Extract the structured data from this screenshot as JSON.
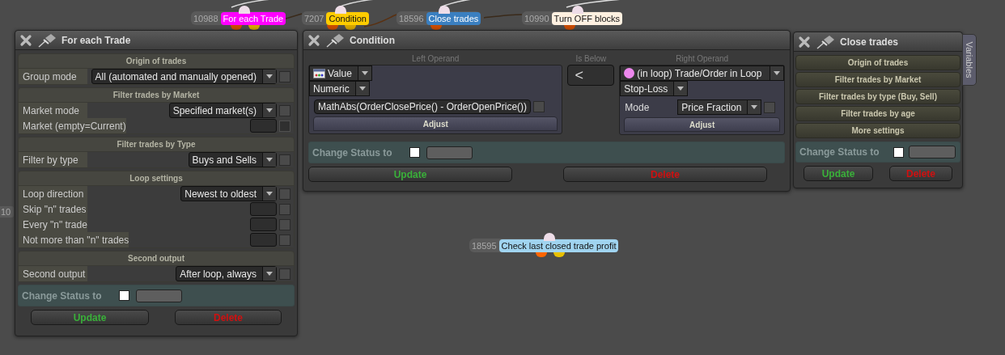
{
  "nodes": [
    {
      "number": "10988",
      "label": "For each Trade",
      "color": "#ff00ff",
      "outputs": [
        {
          "color": "#c84a00"
        },
        {
          "color": "#d4a400"
        }
      ]
    },
    {
      "number": "7207",
      "label": "Condition",
      "color": "#ffcc00",
      "outputs": [
        {
          "color": "#c84a00"
        },
        {
          "color": "#d4a400"
        }
      ]
    },
    {
      "number": "18596",
      "label": "Close trades",
      "color": "#3a7fc0",
      "outputs": [
        {
          "color": "#c84a00"
        }
      ]
    },
    {
      "number": "10990",
      "label": "Turn OFF blocks",
      "color": "#fff0e0",
      "outputs": [
        {
          "color": "#c84a00"
        }
      ]
    },
    {
      "number": "18595",
      "label": "Check last closed trade profit",
      "color": "#a0d4f0",
      "outputs": [
        {
          "color": "#ff6600"
        },
        {
          "color": "#e8c000"
        }
      ]
    }
  ],
  "cut_node": {
    "number": "10"
  },
  "for_each_panel": {
    "title": "For each Trade",
    "sections": [
      {
        "heading": "Origin of trades",
        "rows": [
          {
            "kind": "select",
            "label": "Group mode",
            "value": "All (automated and manually opened)",
            "checked": false,
            "disabled": false
          }
        ]
      },
      {
        "heading": "Filter trades by Market",
        "rows": [
          {
            "kind": "select",
            "label": "Market mode",
            "value": "Specified market(s)",
            "checked": false,
            "disabled": false
          },
          {
            "kind": "input",
            "label": "Market (empty=Current)",
            "checked": false,
            "disabled": true
          }
        ]
      },
      {
        "heading": "Filter trades by Type",
        "rows": [
          {
            "kind": "select",
            "label": "Filter by type",
            "value": "Buys and Sells",
            "checked": false,
            "disabled": false
          }
        ]
      },
      {
        "heading": "Loop settings",
        "rows": [
          {
            "kind": "select",
            "label": "Loop direction",
            "value": "Newest to oldest",
            "checked": false,
            "disabled": false
          },
          {
            "kind": "input",
            "label": "Skip \"n\" trades",
            "checked": false,
            "disabled": false
          },
          {
            "kind": "input",
            "label": "Every \"n\" trade",
            "checked": false,
            "disabled": false
          },
          {
            "kind": "input",
            "label": "Not more than \"n\" trades",
            "checked": false,
            "disabled": false
          }
        ]
      },
      {
        "heading": "Second output",
        "rows": [
          {
            "kind": "select",
            "label": "Second output",
            "value": "After loop, always",
            "checked": false,
            "disabled": false
          }
        ]
      }
    ],
    "status": "Change Status to",
    "buttons": [
      {
        "kind": "update",
        "label": "Update"
      },
      {
        "kind": "delete",
        "label": "Delete"
      }
    ]
  },
  "condition_panel": {
    "title": "Condition",
    "left_operand": {
      "heading": "Left Operand",
      "type": "Value",
      "subtype": "Numeric",
      "expression": "MathAbs(OrderClosePrice() - OrderOpenPrice())",
      "checked": false,
      "adjust": "Adjust"
    },
    "comparator": {
      "heading": "Is Below",
      "value": "<"
    },
    "right_operand": {
      "heading": "Right Operand",
      "source": "(in loop) Trade/Order in Loop",
      "field": "Stop-Loss",
      "mode_label": "Mode",
      "mode": "Price Fraction",
      "checked": false,
      "adjust": "Adjust"
    },
    "status": "Change Status to",
    "buttons": [
      {
        "kind": "update",
        "label": "Update"
      },
      {
        "kind": "delete",
        "label": "Delete"
      }
    ]
  },
  "close_panel": {
    "title": "Close trades",
    "sections": [
      "Origin of trades",
      "Filter trades by Market",
      "Filter trades by type (Buy, Sell)",
      "Filter trades by age",
      "More settings"
    ],
    "status": "Change Status to",
    "buttons": [
      {
        "kind": "update",
        "label": "Update"
      },
      {
        "kind": "delete",
        "label": "Delete"
      }
    ],
    "side_tab": "Variables"
  }
}
